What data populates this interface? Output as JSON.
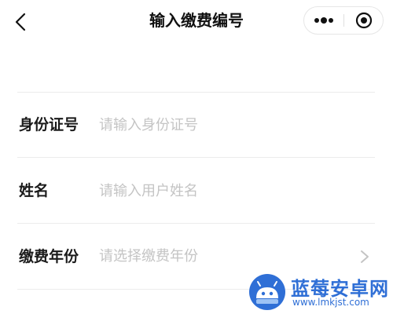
{
  "nav": {
    "title": "输入缴费编号",
    "back_icon": "chevron-left-icon",
    "more_icon": "more-dots-icon",
    "close_icon": "target-close-icon"
  },
  "form": {
    "fields": [
      {
        "label": "身份证号",
        "placeholder": "请输入身份证号",
        "type": "input"
      },
      {
        "label": "姓名",
        "placeholder": "请输入用户姓名",
        "type": "input"
      },
      {
        "label": "缴费年份",
        "placeholder": "请选择缴费年份",
        "type": "select",
        "icon": "chevron-right-icon"
      }
    ]
  },
  "watermark": {
    "title": "蓝莓安卓网",
    "url": "www.lmkjst.com"
  },
  "colors": {
    "text": "#1a1a1a",
    "placeholder": "#c4c4c4",
    "divider": "#ececec",
    "watermark": "#2f6fd6"
  }
}
